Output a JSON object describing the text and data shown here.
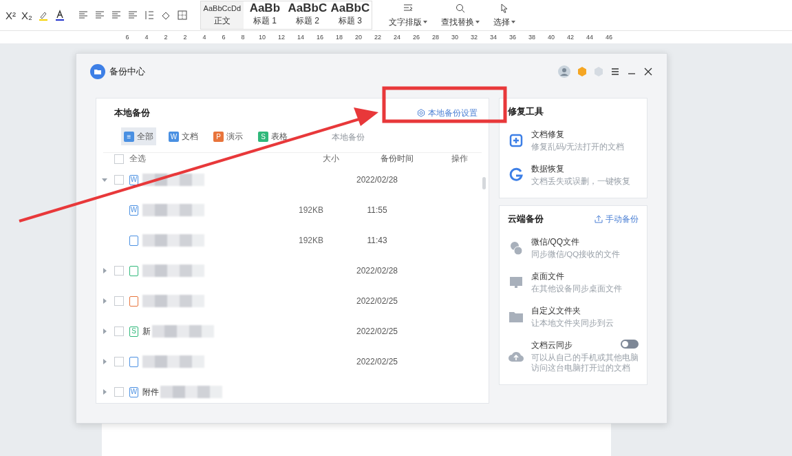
{
  "ribbon": {
    "format_keys": [
      "X²",
      "X₂"
    ],
    "styles": [
      {
        "sample": "AaBbCcDd",
        "label": "正文",
        "selected": true
      },
      {
        "sample": "AaBb",
        "label": "标题 1",
        "selected": false
      },
      {
        "sample": "AaBbC",
        "label": "标题 2",
        "selected": false
      },
      {
        "sample": "AaBbC",
        "label": "标题 3",
        "selected": false
      }
    ],
    "buttons": [
      {
        "label": "文字排版",
        "kind": "layout"
      },
      {
        "label": "查找替换",
        "kind": "find"
      },
      {
        "label": "选择",
        "kind": "select"
      }
    ]
  },
  "ruler": [
    "6",
    "4",
    "2",
    "2",
    "4",
    "6",
    "8",
    "10",
    "12",
    "14",
    "16",
    "18",
    "20",
    "22",
    "24",
    "26",
    "28",
    "30",
    "32",
    "34",
    "36",
    "38",
    "40",
    "42",
    "44",
    "46"
  ],
  "window": {
    "title": "备份中心"
  },
  "local_backup": {
    "title": "本地备份",
    "settings_link": "本地备份设置",
    "filters": [
      {
        "label": "全部",
        "badge": "≡",
        "kind": "all",
        "selected": true
      },
      {
        "label": "文档",
        "badge": "W",
        "kind": "doc",
        "selected": false
      },
      {
        "label": "演示",
        "badge": "P",
        "kind": "ppt",
        "selected": false
      },
      {
        "label": "表格",
        "badge": "S",
        "kind": "sheet",
        "selected": false
      },
      {
        "label": "本地备份",
        "kind": "local",
        "selected": false
      }
    ],
    "columns": [
      "全选",
      "大小",
      "备份时间",
      "操作"
    ],
    "select_all_checked": false,
    "rows": [
      {
        "kind": "doc",
        "badge": "W",
        "date": "2022/02/28",
        "checked": false,
        "expanded": true,
        "children": [
          {
            "kind": "doc",
            "badge": "W",
            "size": "192KB",
            "time": "11:55"
          },
          {
            "kind": "doc",
            "size": "192KB",
            "time": "11:43"
          }
        ]
      },
      {
        "kind": "sheet",
        "date": "2022/02/28",
        "checked": false,
        "expanded": false
      },
      {
        "kind": "ppt",
        "date": "2022/02/25",
        "checked": false,
        "expanded": false
      },
      {
        "kind": "sheet",
        "badge": "S",
        "name": "新",
        "date": "2022/02/25",
        "checked": false,
        "expanded": false
      },
      {
        "kind": "doc",
        "date": "2022/02/25",
        "checked": false,
        "expanded": false
      },
      {
        "kind": "doc",
        "badge": "W",
        "name": "附件",
        "checked": false,
        "expanded": false
      }
    ]
  },
  "repair_tools": {
    "title": "修复工具",
    "items": [
      {
        "kind": "repair",
        "title": "文档修复",
        "desc": "修复乱码/无法打开的文档"
      },
      {
        "kind": "recover",
        "title": "数据恢复",
        "desc": "文档丢失或误删，一键恢复"
      }
    ]
  },
  "cloud_backup": {
    "title": "云端备份",
    "action": "手动备份",
    "items": [
      {
        "kind": "chat",
        "title": "微信/QQ文件",
        "desc": "同步微信/QQ接收的文件"
      },
      {
        "kind": "desktop",
        "title": "桌面文件",
        "desc": "在其他设备同步桌面文件"
      },
      {
        "kind": "folder",
        "title": "自定义文件夹",
        "desc": "让本地文件夹同步到云"
      },
      {
        "kind": "cloud",
        "on": false,
        "title": "文档云同步",
        "desc": "可以从自己的手机或其他电脑访问这台电脑打开过的文档"
      }
    ]
  }
}
